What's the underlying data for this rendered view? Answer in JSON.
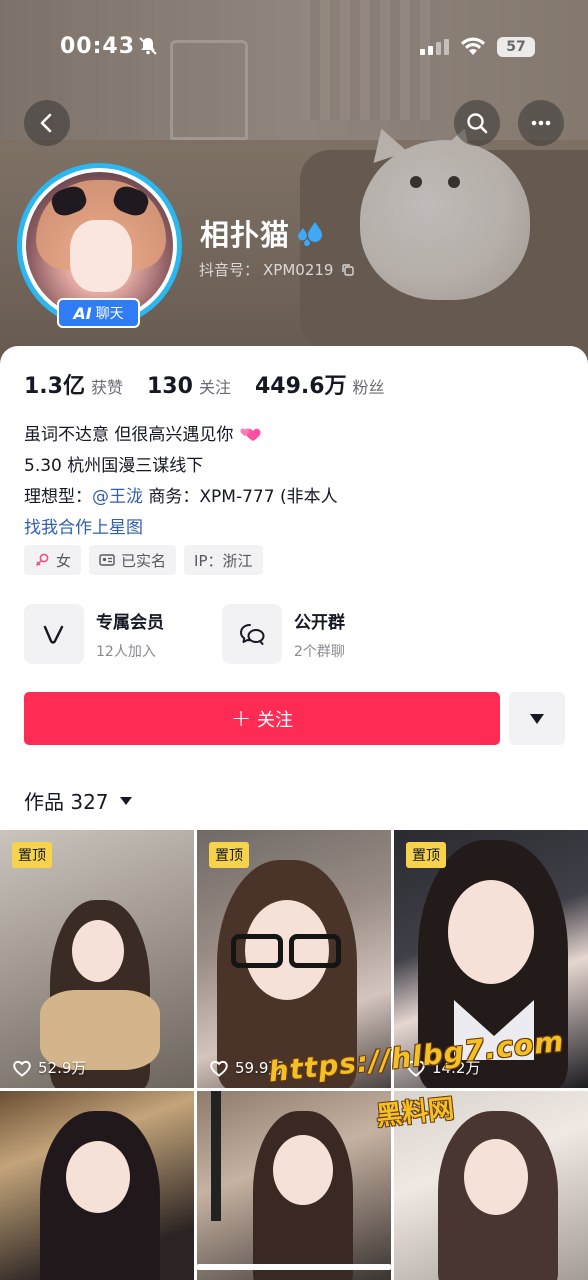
{
  "status_bar": {
    "time": "00:43",
    "battery": "57"
  },
  "profile": {
    "name": "相扑猫",
    "account_label": "抖音号：",
    "account_id": "XPM0219",
    "ai_badge_prefix": "AI",
    "ai_badge_label": "聊天",
    "avatar_ring_color": "#2bb8f0"
  },
  "stats": [
    {
      "value": "1.3亿",
      "label": "获赞"
    },
    {
      "value": "130",
      "label": "关注"
    },
    {
      "value": "449.6万",
      "label": "粉丝"
    }
  ],
  "bio": {
    "line1": "虽词不达意 但很高兴遇见你",
    "line2": "5.30 杭州国漫三谋线下",
    "line3_prefix": "理想型：",
    "line3_mention": "@王泷",
    "line3_suffix": " 商务：XPM-777 (非本人",
    "line4_link": "找我合作上星图"
  },
  "tags": [
    {
      "icon": "female-icon",
      "label": "女"
    },
    {
      "icon": "id-card-icon",
      "label": "已实名"
    },
    {
      "icon": "",
      "label": "IP：浙江"
    }
  ],
  "features": {
    "member": {
      "title": "专属会员",
      "subtitle": "12人加入",
      "icon": "vip-v-icon"
    },
    "group": {
      "title": "公开群",
      "subtitle": "2个群聊",
      "icon": "chat-bubbles-icon"
    }
  },
  "actions": {
    "follow_label": "关注",
    "follow_color": "#fe2c55"
  },
  "works": {
    "label": "作品",
    "count": "327"
  },
  "grid": [
    {
      "pinned": "置顶",
      "likes": "52.9万"
    },
    {
      "pinned": "置顶",
      "likes": "59.9万"
    },
    {
      "pinned": "置顶",
      "likes": "14.2万"
    },
    {
      "pinned": "",
      "likes": ""
    },
    {
      "pinned": "",
      "likes": ""
    },
    {
      "pinned": "",
      "likes": ""
    }
  ],
  "watermark": {
    "url": "https://hlbg7.com",
    "name": "黑料网"
  }
}
